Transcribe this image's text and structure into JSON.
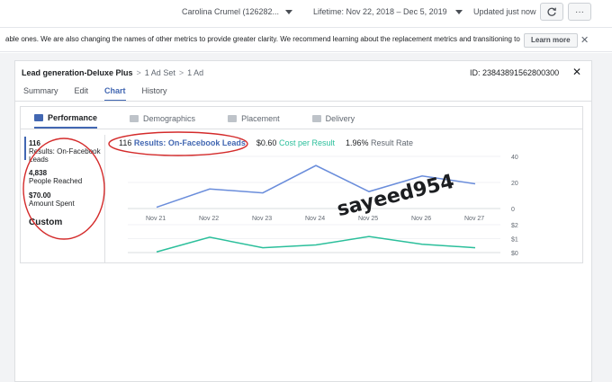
{
  "topbar": {
    "account": "Carolina Crumel (126282...",
    "lifetime": "Lifetime: Nov 22, 2018 – Dec 5, 2019",
    "updated": "Updated just now",
    "refresh_icon": "refresh-icon",
    "more_icon": "more-icon",
    "more_label": "···"
  },
  "notice": {
    "text": "able ones. We are also changing the names of other metrics to provide greater clarity. We recommend learning about the replacement metrics and transitioning to",
    "learn_more": "Learn more",
    "close": "✕"
  },
  "panel": {
    "breadcrumb": {
      "campaign": "Lead generation-Deluxe Plus",
      "sep1": ">",
      "ad_set": "1 Ad Set",
      "sep2": ">",
      "ad": "1 Ad"
    },
    "id": "ID: 23843891562800300",
    "close": "✕",
    "tabs": [
      "Summary",
      "Edit",
      "Chart",
      "History"
    ],
    "active_tab": "Chart"
  },
  "chart_tabs": {
    "items": [
      "Performance",
      "Demographics",
      "Placement",
      "Delivery"
    ],
    "active": "Performance",
    "colors": {
      "active_icon": "#4267b2",
      "inactive_icon": "#bec3c9"
    }
  },
  "metrics": [
    {
      "value": "116",
      "label": "Results: On-Facebook Leads"
    },
    {
      "value": "4,838",
      "label": "People Reached"
    },
    {
      "value": "$70.00",
      "label": "Amount Spent"
    }
  ],
  "custom_label": "Custom",
  "summary": {
    "results_count": "116",
    "results_label": "Results: On-Facebook Leads",
    "cost_value": "$0.60",
    "cost_label": "Cost per Result",
    "rate_value": "1.96%",
    "rate_label": "Result Rate"
  },
  "watermark": "sayeed954",
  "colors": {
    "accent": "#4267b2",
    "results_line": "#6a8ddb",
    "cost_line": "#2bbf9b",
    "annotation": "#d42b2b"
  },
  "chart_data": [
    {
      "type": "line",
      "categories": [
        "Nov 21",
        "Nov 22",
        "Nov 23",
        "Nov 24",
        "Nov 25",
        "Nov 26",
        "Nov 27"
      ],
      "series": [
        {
          "name": "Results: On-Facebook Leads",
          "values": [
            1,
            15,
            12,
            33,
            13,
            25,
            19
          ]
        }
      ],
      "yticks": [
        "40",
        "20",
        "0"
      ],
      "ylim": [
        0,
        40
      ]
    },
    {
      "type": "line",
      "categories": [
        "Nov 21",
        "Nov 22",
        "Nov 23",
        "Nov 24",
        "Nov 25",
        "Nov 26",
        "Nov 27"
      ],
      "series": [
        {
          "name": "Cost per Result",
          "values": [
            0.05,
            1.1,
            0.35,
            0.55,
            1.15,
            0.6,
            0.35
          ]
        }
      ],
      "yticks": [
        "$2",
        "$1",
        "$0"
      ],
      "ylim": [
        0,
        2
      ]
    }
  ]
}
